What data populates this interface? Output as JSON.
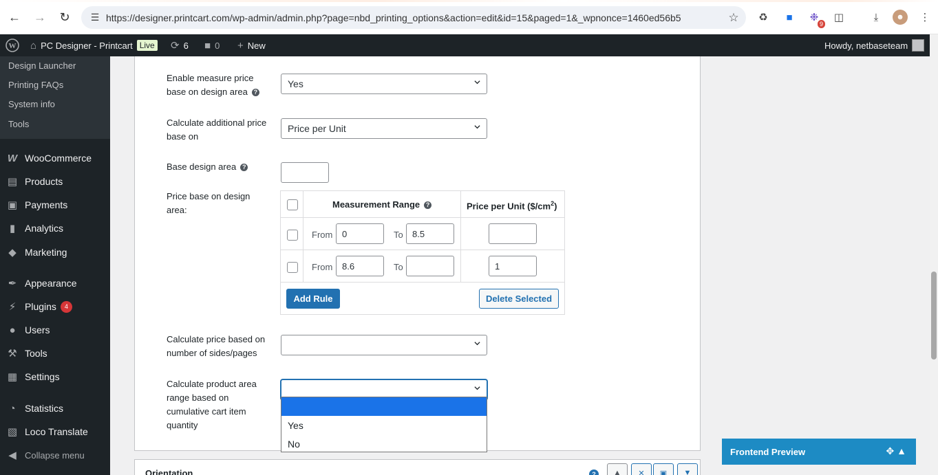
{
  "browser": {
    "url": "https://designer.printcart.com/wp-admin/admin.php?page=nbd_printing_options&action=edit&id=15&paged=1&_wpnonce=1460ed56b5",
    "ext_badge": "9"
  },
  "adminbar": {
    "site_name": "PC Designer - Printcart",
    "live_label": "Live",
    "updates_count": "6",
    "comments_count": "0",
    "new_label": "New",
    "howdy": "Howdy, netbaseteam"
  },
  "sidebar": {
    "submenu": [
      "Design Launcher",
      "Printing FAQs",
      "System info",
      "Tools"
    ],
    "items": [
      {
        "label": "WooCommerce",
        "icon": "woo-icon"
      },
      {
        "label": "Products",
        "icon": "products-icon"
      },
      {
        "label": "Payments",
        "icon": "payments-icon"
      },
      {
        "label": "Analytics",
        "icon": "analytics-icon"
      },
      {
        "label": "Marketing",
        "icon": "marketing-icon"
      },
      {
        "label": "Appearance",
        "icon": "appearance-icon"
      },
      {
        "label": "Plugins",
        "icon": "plugins-icon",
        "badge": "4"
      },
      {
        "label": "Users",
        "icon": "users-icon"
      },
      {
        "label": "Tools",
        "icon": "tools-icon"
      },
      {
        "label": "Settings",
        "icon": "settings-icon"
      },
      {
        "label": "Statistics",
        "icon": "statistics-icon"
      },
      {
        "label": "Loco Translate",
        "icon": "translate-icon"
      }
    ],
    "collapse_label": "Collapse menu"
  },
  "form": {
    "measure_label_1": "Enable measure price",
    "measure_label_2": "base on design area",
    "measure_value": "Yes",
    "additional_label_1": "Calculate additional price",
    "additional_label_2": "base on",
    "additional_value": "Price per Unit",
    "base_area_label": "Base design area",
    "base_area_value": "",
    "price_area_label_1": "Price base on design",
    "price_area_label_2": "area:",
    "table": {
      "header_range": "Measurement Range",
      "header_price": "Price per Unit ($/cm",
      "header_price_sup": "2",
      "header_price_close": ")",
      "from_label": "From",
      "to_label": "To",
      "rows": [
        {
          "from": "0",
          "to": "8.5",
          "price": ""
        },
        {
          "from": "8.6",
          "to": "",
          "price": "1"
        }
      ],
      "add_rule": "Add Rule",
      "delete_selected": "Delete Selected"
    },
    "sides_label_1": "Calculate price based on",
    "sides_label_2": "number of sides/pages",
    "sides_value": "",
    "cart_label_1": "Calculate product area",
    "cart_label_2": "range based on",
    "cart_label_3": "cumulative cart item",
    "cart_label_4": "quantity",
    "cart_value": "",
    "cart_options": [
      "",
      "Yes",
      "No"
    ]
  },
  "next_panel": {
    "title": "Orientation"
  },
  "preview": {
    "label": "Frontend Preview"
  },
  "colors": {
    "wp_dark": "#1d2327",
    "wp_blue": "#2271b1",
    "preview_blue": "#1d8bc4",
    "select_highlight": "#1a73e8"
  }
}
